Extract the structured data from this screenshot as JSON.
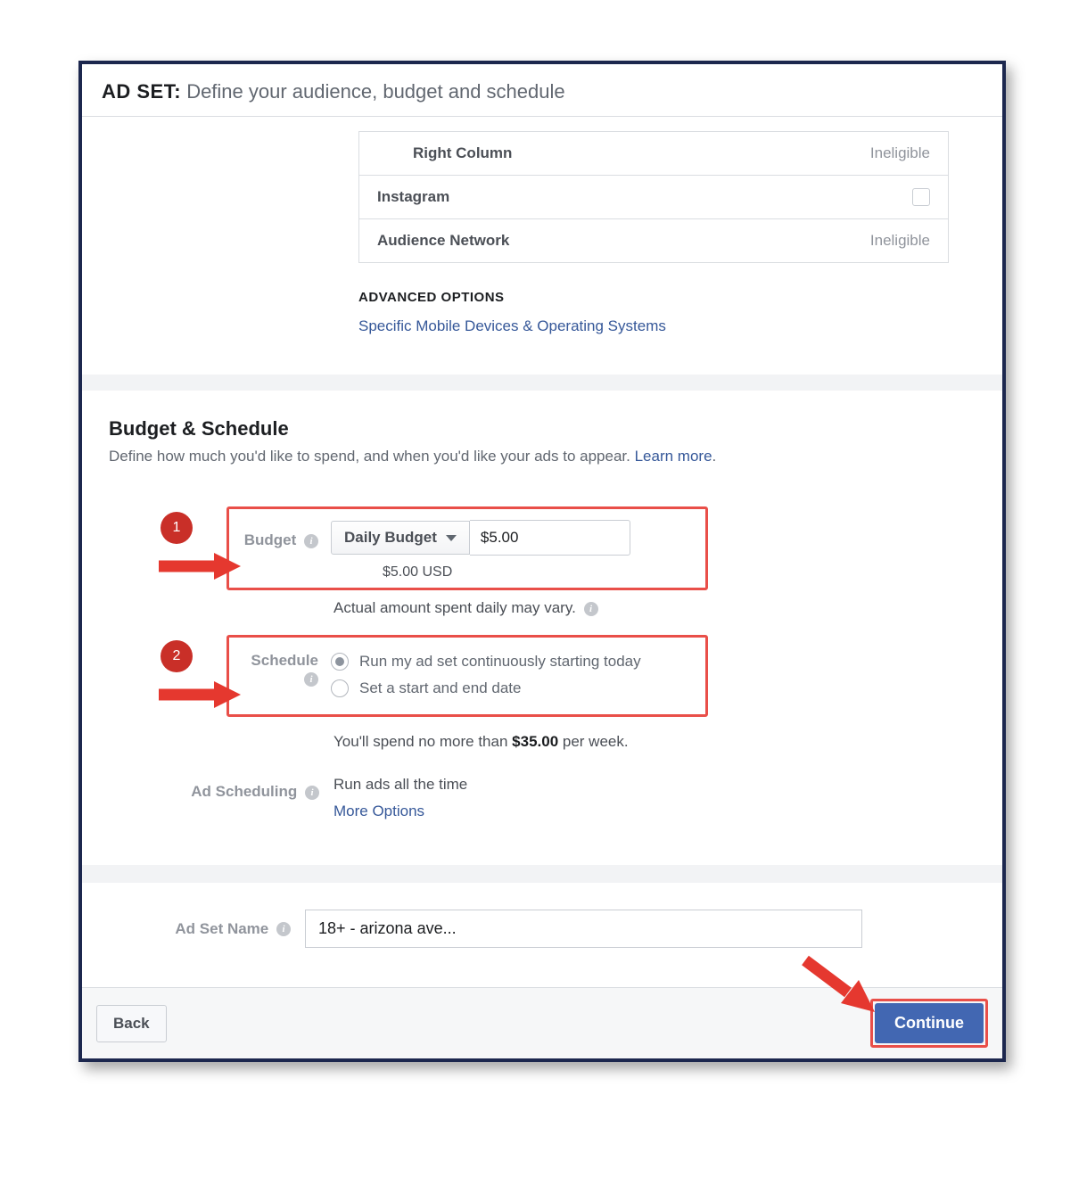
{
  "header": {
    "prefix": "AD SET:",
    "desc": "Define your audience, budget and schedule"
  },
  "placements": {
    "rows": [
      {
        "label": "Right Column",
        "status": "Ineligible",
        "sub": true
      },
      {
        "label": "Instagram",
        "status": "",
        "sub": false,
        "checkbox": true
      },
      {
        "label": "Audience Network",
        "status": "Ineligible",
        "sub": false
      }
    ],
    "advanced_title": "ADVANCED OPTIONS",
    "advanced_link": "Specific Mobile Devices & Operating Systems"
  },
  "budget_section": {
    "title": "Budget & Schedule",
    "subtitle": "Define how much you'd like to spend, and when you'd like your ads to appear. ",
    "learn_more": "Learn more",
    "budget_label": "Budget",
    "budget_type": "Daily Budget",
    "budget_amount": "$5.00",
    "budget_usd": "$5.00 USD",
    "budget_note": "Actual amount spent daily may vary.",
    "schedule_label": "Schedule",
    "schedule_opt1": "Run my ad set continuously starting today",
    "schedule_opt2": "Set a start and end date",
    "spend_note_pre": "You'll spend no more than ",
    "spend_amount": "$35.00",
    "spend_note_post": " per week.",
    "ad_scheduling_label": "Ad Scheduling",
    "ad_scheduling_value": "Run ads all the time",
    "more_options": "More Options"
  },
  "callouts": {
    "one": "1",
    "two": "2"
  },
  "name_row": {
    "label": "Ad Set Name",
    "value": "18+ - arizona ave..."
  },
  "footer": {
    "back": "Back",
    "continue": "Continue"
  }
}
